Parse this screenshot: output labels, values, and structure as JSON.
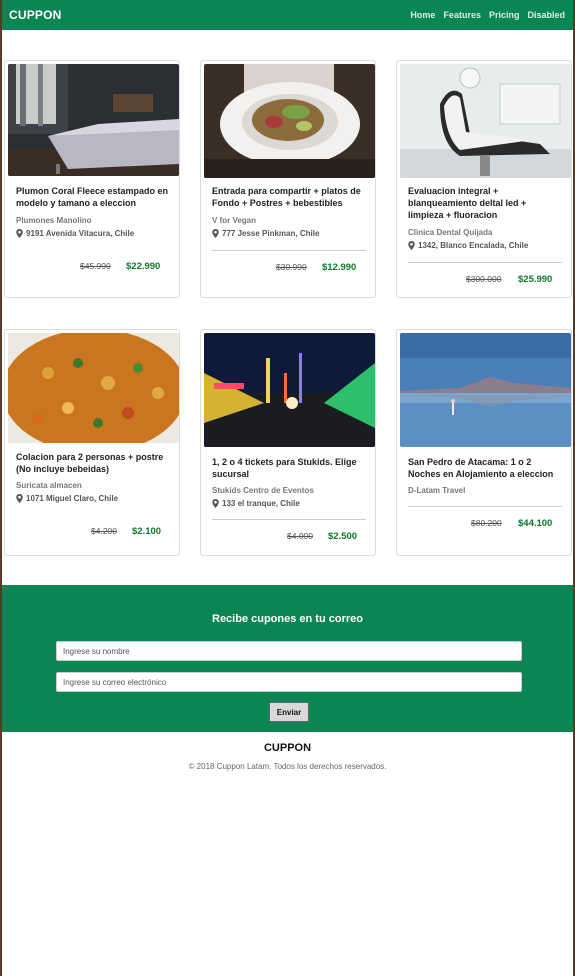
{
  "navbar": {
    "brand": "CUPPON",
    "links": [
      "Home",
      "Features",
      "Pricing",
      "Disabled"
    ]
  },
  "deals": [
    {
      "title": "Plumon Coral Fleece estampado en modelo y tamano a eleccion",
      "vendor": "Plumones Manolino",
      "address": "9191 Avenida Vitacura, Chile",
      "old_price": "$45.990",
      "new_price": "$22.990",
      "image": "bedroom"
    },
    {
      "title": "Entrada para compartir + platos de Fondo + Postres + bebestibles",
      "vendor": "V for Vegan",
      "address": "777 Jesse Pinkman, Chile",
      "old_price": "$30.990",
      "new_price": "$12.990",
      "image": "salad"
    },
    {
      "title": "Evaluacion integral + blanqueamiento deltal led + limpieza + fluoracion",
      "vendor": "Clinica Dental Quijada",
      "address": "1342, Blanco Encalada, Chile",
      "old_price": "$300.000",
      "new_price": "$25.990",
      "image": "dental-chair"
    },
    {
      "title": "Colacion para 2 personas + postre (No incluye bebeidas)",
      "vendor": "Suricata almacen",
      "address": "1071 Miguel Claro, Chile",
      "old_price": "$4.200",
      "new_price": "$2.100",
      "image": "curry"
    },
    {
      "title": "1, 2 o 4 tickets para Stukids. Elige sucursal",
      "vendor": "Stukids Centro de Eventos",
      "address": "133 el tranque, Chile",
      "old_price": "$4.000",
      "new_price": "$2.500",
      "image": "fair"
    },
    {
      "title": "San Pedro de Atacama: 1 o 2 Noches en Alojamiento a eleccion",
      "vendor": "D-Latam Travel",
      "address": "",
      "old_price": "$80.200",
      "new_price": "$44.100",
      "image": "lake"
    }
  ],
  "newsletter": {
    "title": "Recibe cupones en tu correo",
    "name_placeholder": "Ingrese su nombre",
    "email_placeholder": "Ingrese su correo electrónico",
    "submit_label": "Enviar"
  },
  "footer": {
    "brand": "CUPPON",
    "copyright": "© 2018 Cuppon Latam. Todos los derechos reservados."
  },
  "colors": {
    "brand_green": "#0b8553",
    "price_green": "#0b7a2a"
  }
}
